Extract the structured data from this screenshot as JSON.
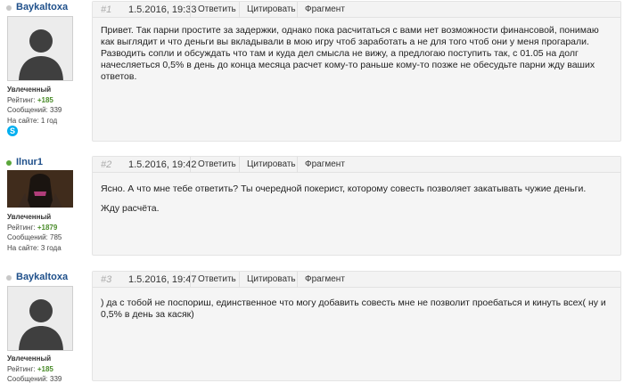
{
  "posts": [
    {
      "author": "Baykaltoxa",
      "online": false,
      "avatar": "default-avatar-icon",
      "rank": "Увлеченный",
      "rating_label": "Рейтинг:",
      "rating": "+185",
      "messages": "Сообщений: 339",
      "on_site": "На сайте: 1 год",
      "has_skype": true,
      "number": "#1",
      "date": "1.5.2016, 19:33",
      "actions": [
        "Ответить",
        "Цитировать",
        "Фрагмент"
      ],
      "paragraphs": [
        "Привет. Так парни простите за задержки, однако пока расчитаться с вами нет возможности финансовой, понимаю как выглядит и что деньги вы вкладывали в мою игру чтоб заработать а не для того чтоб они у меня прогарали. Разводить сопли и обсуждать что там и куда дел смысла не вижу, а предлогаю поступить так, с 01.05 на долг начесляеться 0,5% в день до конца месяца расчет кому-то раньше кому-то позже не обесудьте парни жду ваших ответов."
      ]
    },
    {
      "author": "Ilnur1",
      "online": true,
      "avatar": "hooded-figure-avatar",
      "rank": "Увлеченный",
      "rating_label": "Рейтинг:",
      "rating": "+1879",
      "messages": "Сообщений: 785",
      "on_site": "На сайте: 3 года",
      "has_skype": false,
      "number": "#2",
      "date": "1.5.2016, 19:42",
      "actions": [
        "Ответить",
        "Цитировать",
        "Фрагмент"
      ],
      "paragraphs": [
        "Ясно. А что мне тебе ответить? Ты очередной покерист, которому совесть позволяет закатывать чужие деньги.",
        "Жду расчёта."
      ]
    },
    {
      "author": "Baykaltoxa",
      "online": false,
      "avatar": "default-avatar-icon",
      "rank": "Увлеченный",
      "rating_label": "Рейтинг:",
      "rating": "+185",
      "messages": "Сообщений: 339",
      "on_site": "",
      "has_skype": false,
      "number": "#3",
      "date": "1.5.2016, 19:47",
      "actions": [
        "Ответить",
        "Цитировать",
        "Фрагмент"
      ],
      "paragraphs": [
        ") да с тобой не поспориш, единственное что могу добавить совесть мне не позволит проебаться и кинуть всех( ну и 0,5% в день за касяк)"
      ]
    }
  ]
}
